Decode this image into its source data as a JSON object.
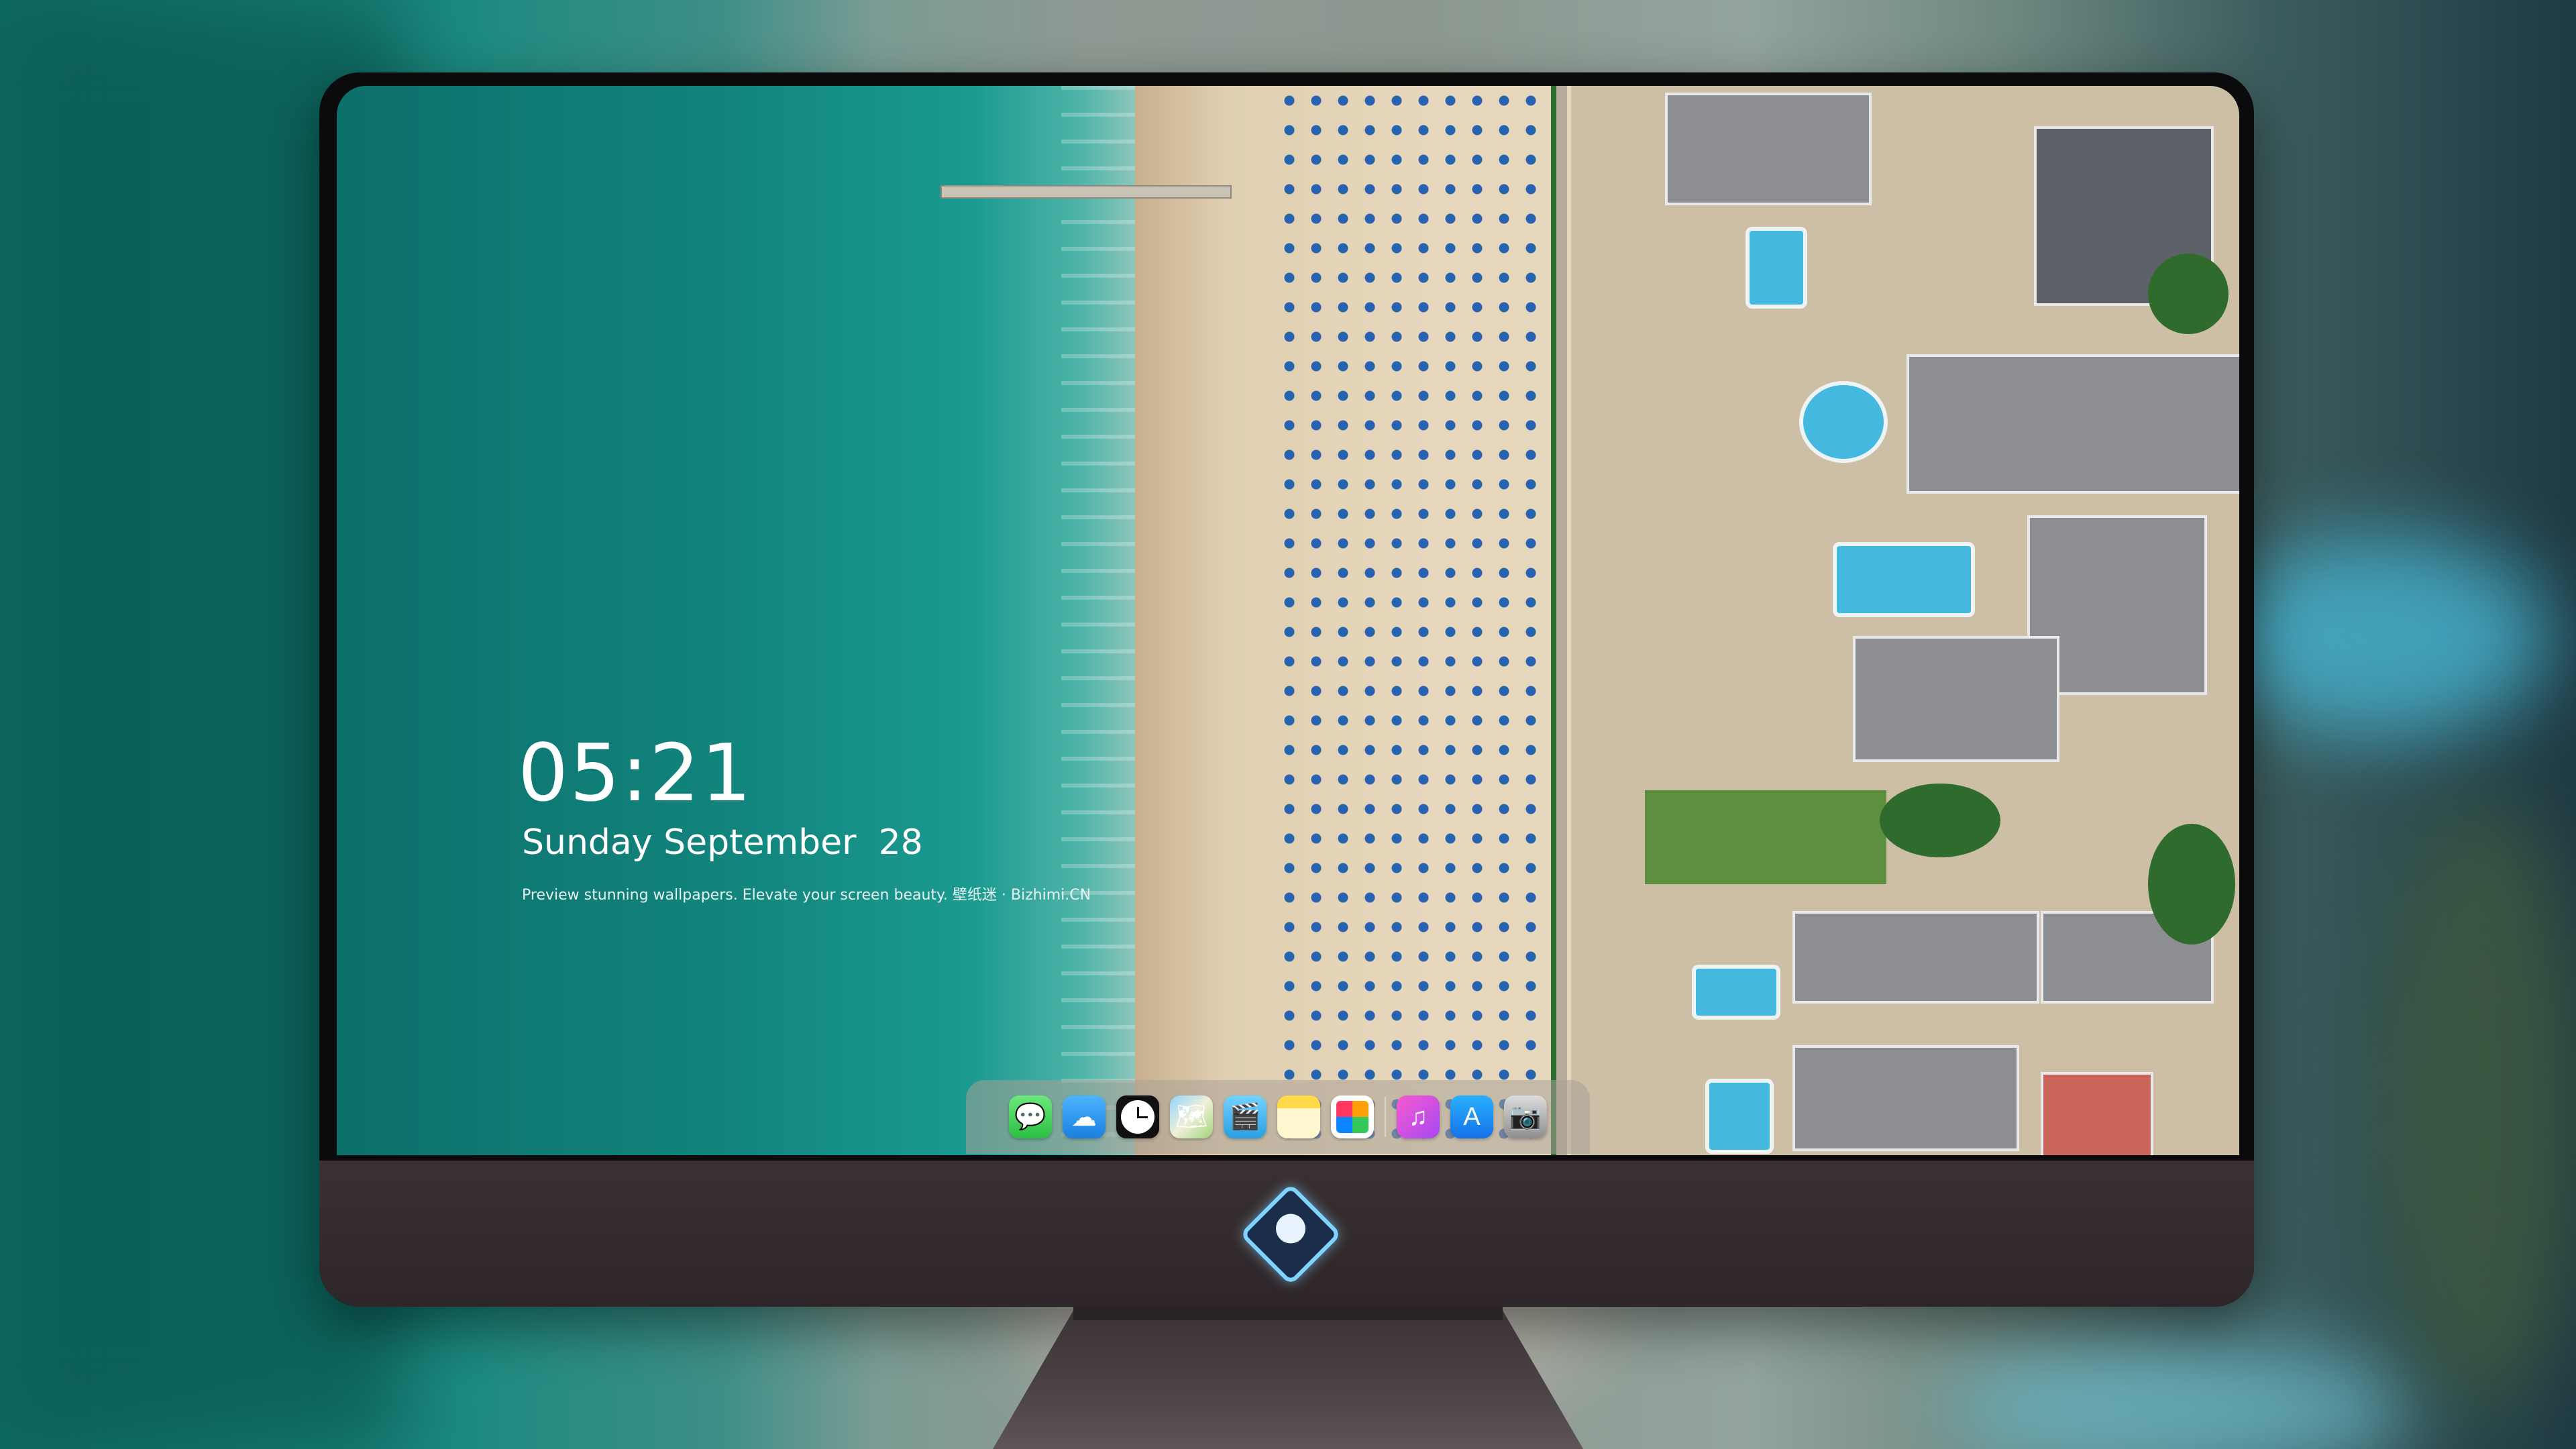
{
  "lockscreen": {
    "time": "05:21",
    "date": "Sunday September  28",
    "tagline": "Preview stunning wallpapers. Elevate your screen beauty. 壁纸迷 · Bizhimi.CN"
  },
  "dock": {
    "icons": [
      {
        "name": "messages-icon",
        "glyph": "💬"
      },
      {
        "name": "weather-icon",
        "glyph": "☁"
      },
      {
        "name": "clock-icon",
        "glyph": ""
      },
      {
        "name": "maps-icon",
        "glyph": "🗺"
      },
      {
        "name": "clips-icon",
        "glyph": "🎬"
      },
      {
        "name": "notes-icon",
        "glyph": ""
      },
      {
        "name": "photos-icon",
        "glyph": ""
      },
      {
        "name": "music-icon",
        "glyph": "♫"
      },
      {
        "name": "app-store-icon",
        "glyph": "A"
      },
      {
        "name": "camera-icon",
        "glyph": "📷"
      }
    ]
  },
  "colors": {
    "monitor_bezel": "#0b0b0d",
    "monitor_chin": "#3a3134",
    "sea": "#11847c",
    "sand": "#e7d8bd",
    "umbrella": "#1d5cb0"
  }
}
